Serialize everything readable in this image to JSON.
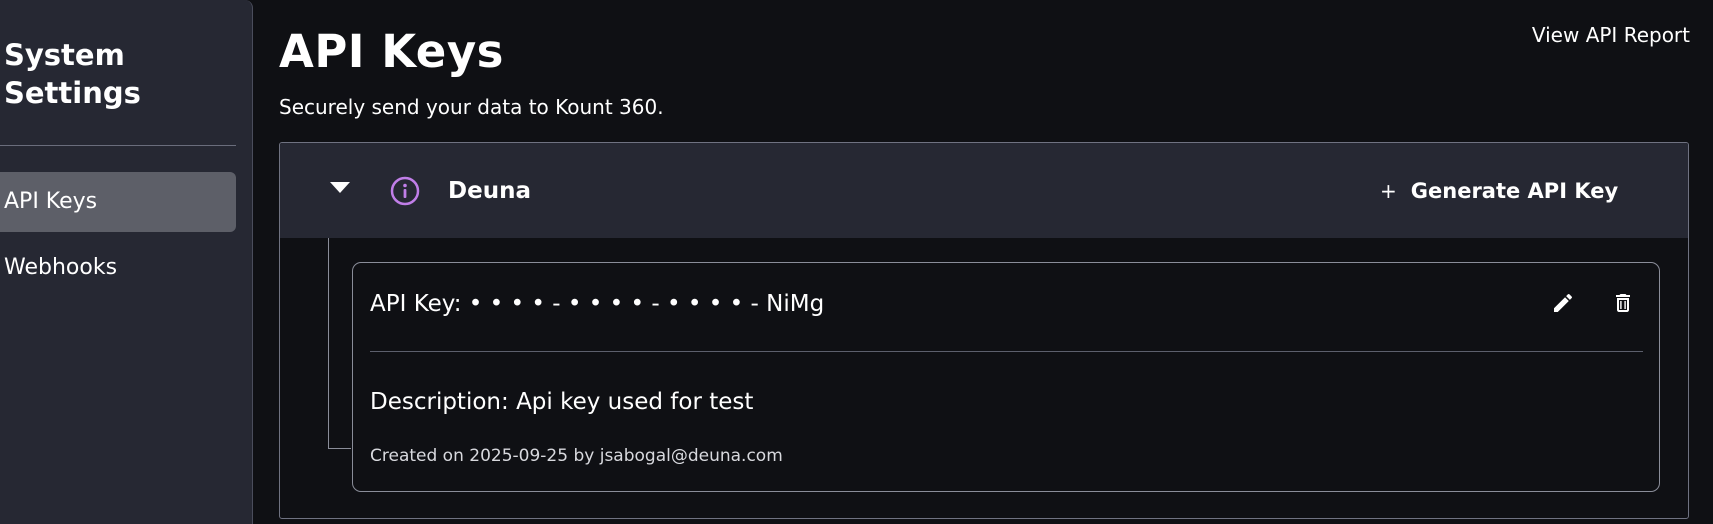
{
  "sidebar": {
    "title": "System\nSettings",
    "items": [
      {
        "label": "API Keys",
        "active": true
      },
      {
        "label": "Webhooks",
        "active": false
      }
    ]
  },
  "header": {
    "title": "API Keys",
    "subtitle": "Securely send your data to Kount 360.",
    "report_link": "View API Report"
  },
  "account": {
    "name": "Deuna",
    "info_icon": "info-circle-icon",
    "generate_label": "Generate API Key",
    "generate_icon": "+"
  },
  "key": {
    "label": "API Key:",
    "masked_value": "• • • • - • • • • - • • • • - NiMg",
    "description_label": "Description:",
    "description": "Api key used for test",
    "created": "Created on 2025-09-25 by jsabogal@deuna.com"
  },
  "colors": {
    "background": "#0f1014",
    "sidebar": "#262833",
    "active_item": "#5d5f68",
    "info_icon": "#c07ee8"
  }
}
